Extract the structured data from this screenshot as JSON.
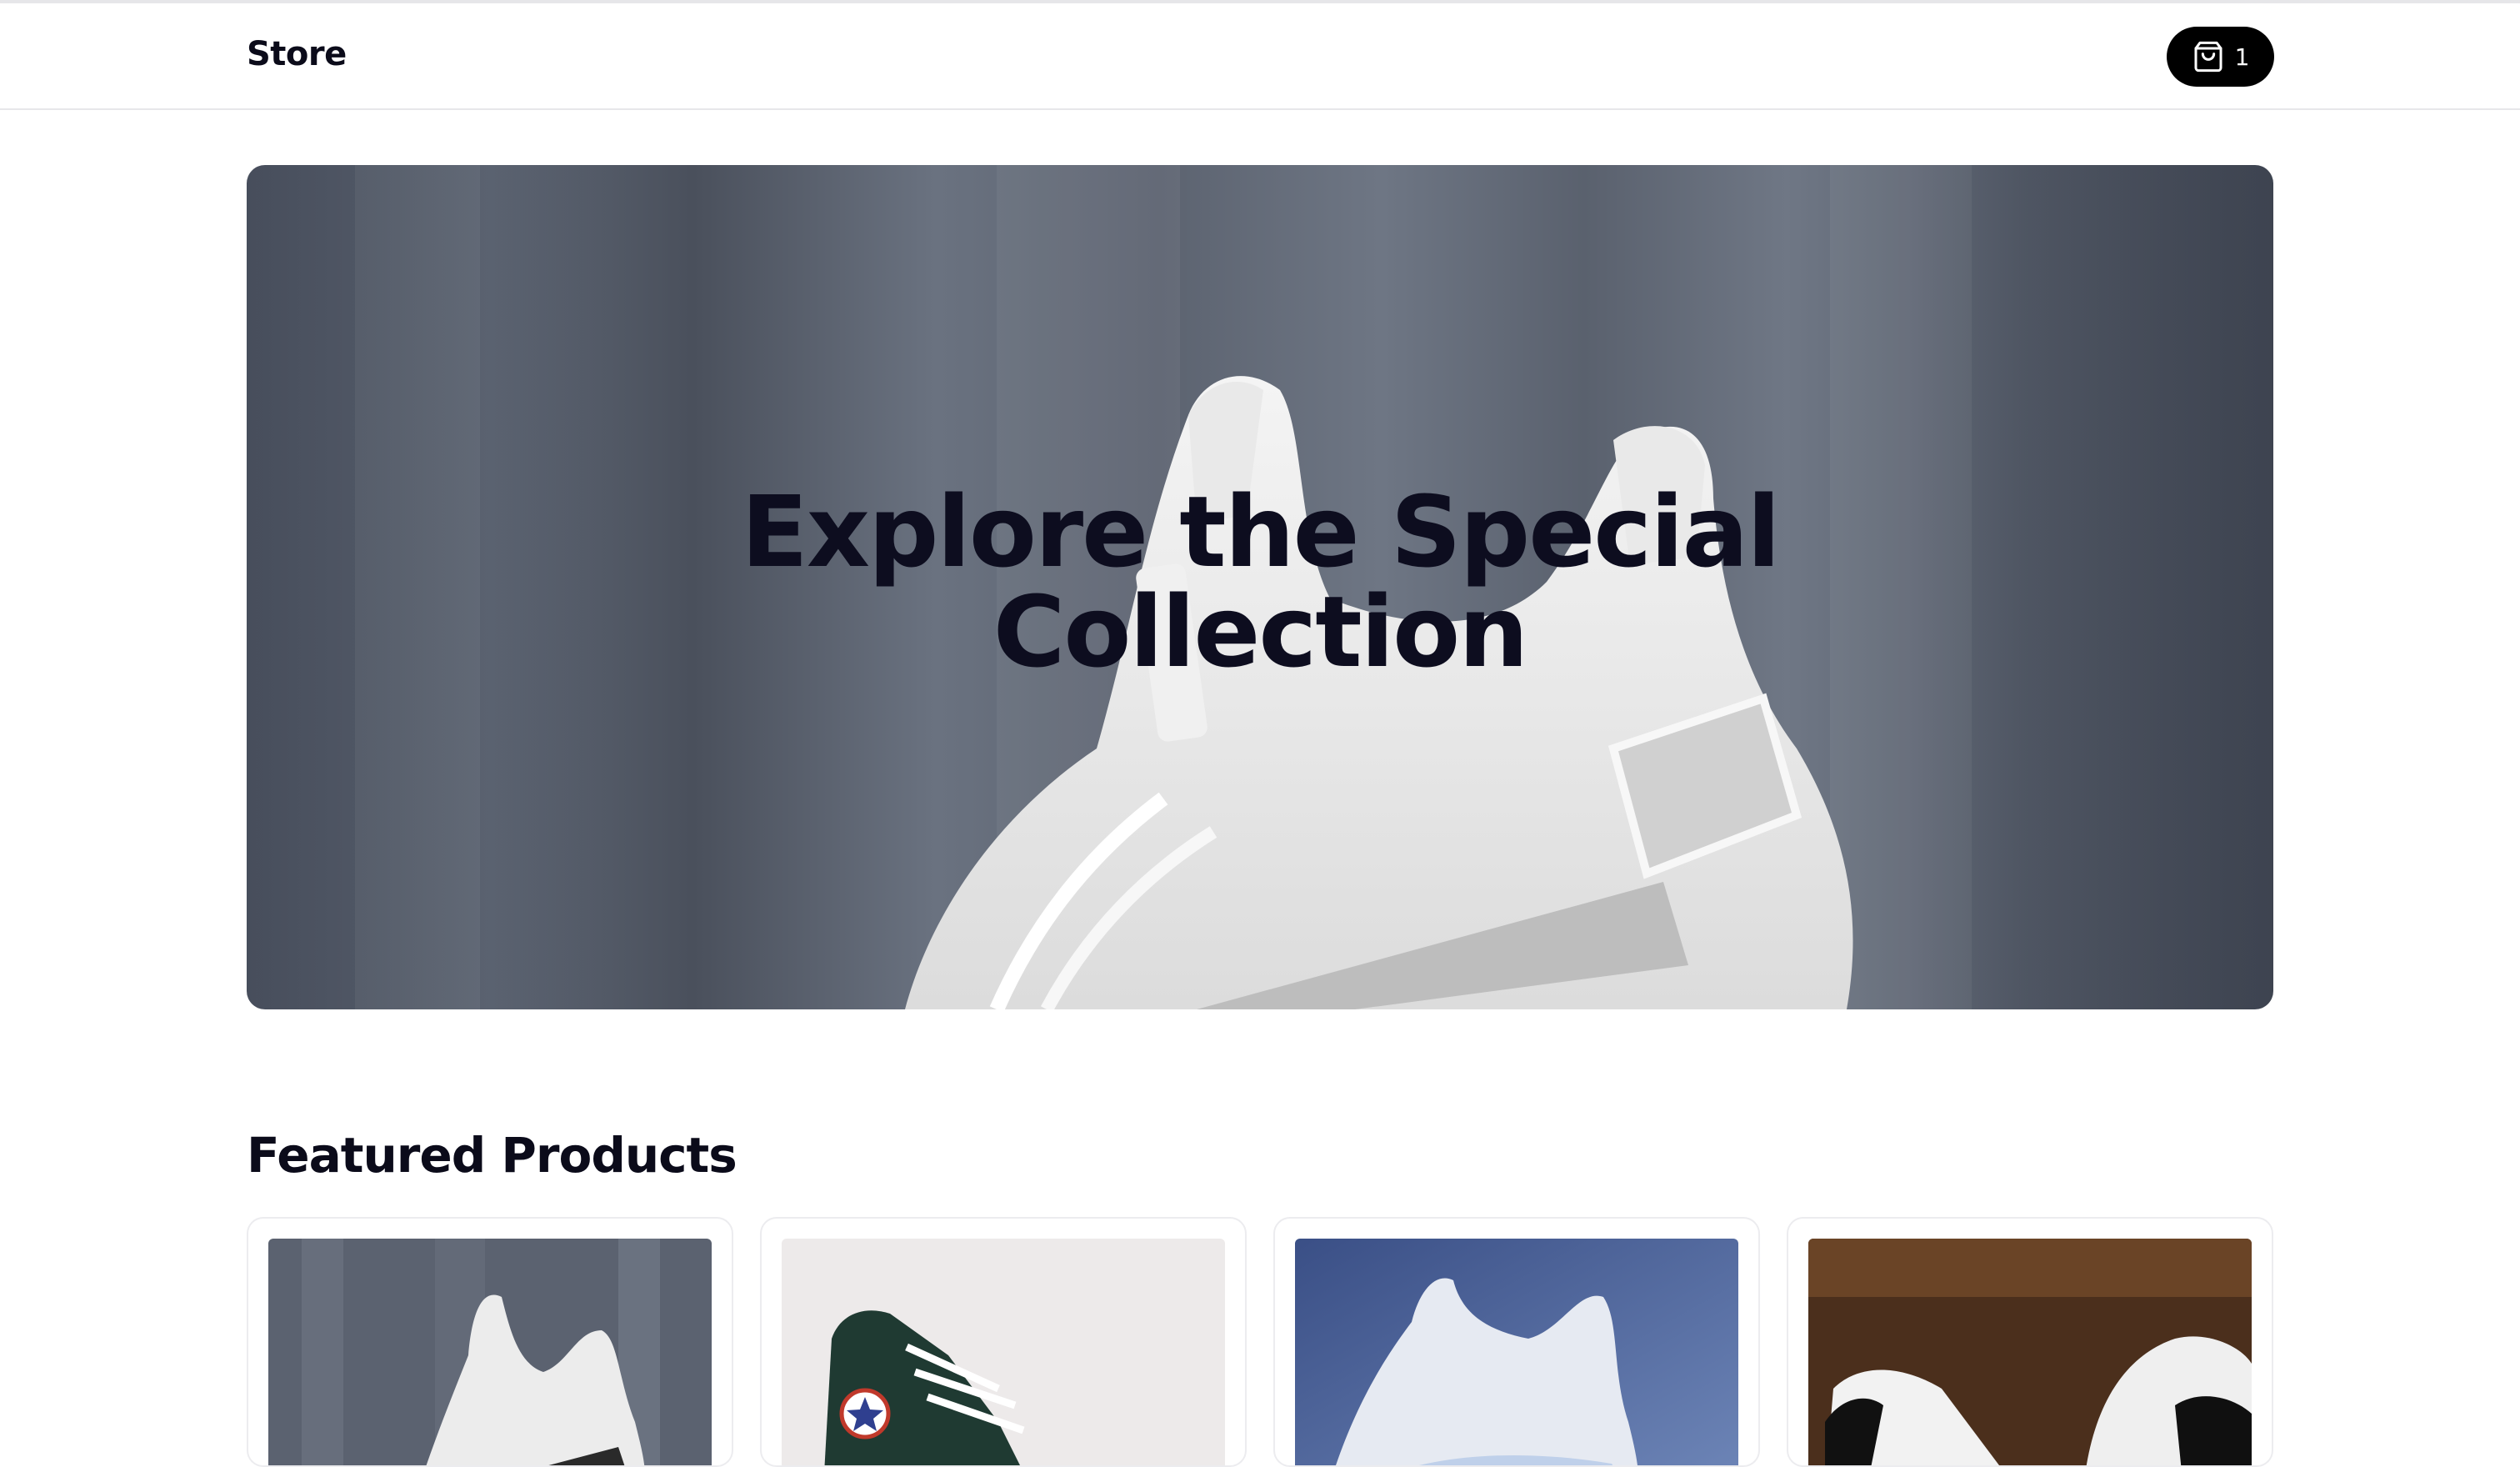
{
  "header": {
    "brand": "Store",
    "cart": {
      "count": "1",
      "icon": "shopping-bag-icon"
    }
  },
  "hero": {
    "title_line1": "Explore the Special",
    "title_line2": "Collection",
    "image": "white-sneaker-hero-image"
  },
  "featured": {
    "title": "Featured Products",
    "products": [
      {
        "image": "white-knit-sneaker-image"
      },
      {
        "image": "green-high-top-sneaker-image"
      },
      {
        "image": "white-running-shoe-image"
      },
      {
        "image": "white-leather-sneaker-image"
      }
    ]
  },
  "colors": {
    "text": "#0b0b1a",
    "cart_button": "#000000",
    "border": "#e7e7ea"
  }
}
